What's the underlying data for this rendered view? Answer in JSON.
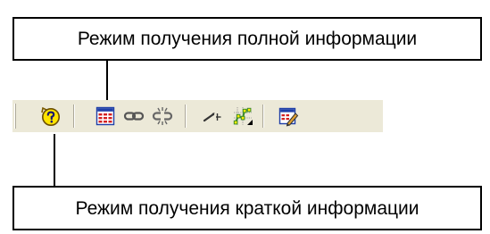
{
  "callouts": {
    "full_info_mode": "Режим получения полной информации",
    "brief_info_mode": "Режим получения краткой информации"
  },
  "toolbar": {
    "buttons": [
      {
        "icon": "help-query-icon"
      },
      {
        "icon": "table-grid-icon"
      },
      {
        "icon": "link-icon"
      },
      {
        "icon": "unlink-icon"
      },
      {
        "icon": "pen-cursor-icon"
      },
      {
        "icon": "polyline-nodes-icon"
      },
      {
        "icon": "edit-properties-icon"
      }
    ]
  },
  "colors": {
    "toolbar_bg": "#ece9d8",
    "help_icon_yellow": "#ffe400",
    "grid_red": "#d42020",
    "grid_blue": "#1f3fa8",
    "node_yellow": "#ffee00",
    "node_green": "#3a8a2a"
  }
}
